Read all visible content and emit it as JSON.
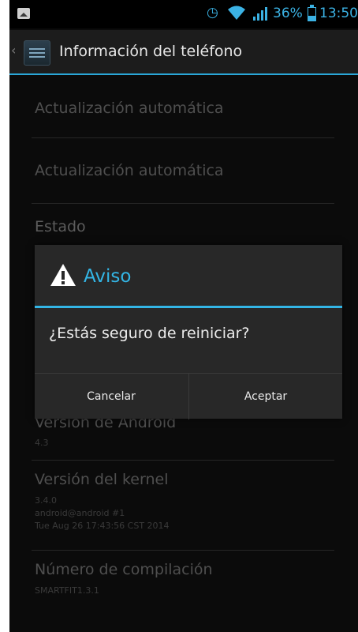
{
  "status_bar": {
    "battery_percent": "36%",
    "battery_level": 0.36,
    "time": "13:50",
    "icons": [
      "notification-image-icon",
      "alarm-icon",
      "wifi-icon",
      "signal-icon",
      "battery-icon"
    ]
  },
  "action_bar": {
    "title": "Información del teléfono"
  },
  "list": {
    "item1": {
      "title": "Actualización automática"
    },
    "item2": {
      "title": "Actualización automática"
    },
    "item3": {
      "title": "Estado"
    },
    "item4": {
      "title": "Versión de Android",
      "summary": "4.3"
    },
    "item5": {
      "title": "Versión del kernel",
      "summary_line1": "3.4.0",
      "summary_line2": "android@android #1",
      "summary_line3": "Tue Aug 26 17:43:56 CST 2014"
    },
    "item6": {
      "title": "Número de compilación",
      "summary": "SMARTFIT1.3.1"
    }
  },
  "dialog": {
    "title": "Aviso",
    "message": "¿Estás seguro de reiniciar?",
    "cancel_label": "Cancelar",
    "accept_label": "Aceptar"
  },
  "colors": {
    "accent": "#33b5e5",
    "background": "#0b0b0b",
    "dialog": "#282828"
  }
}
